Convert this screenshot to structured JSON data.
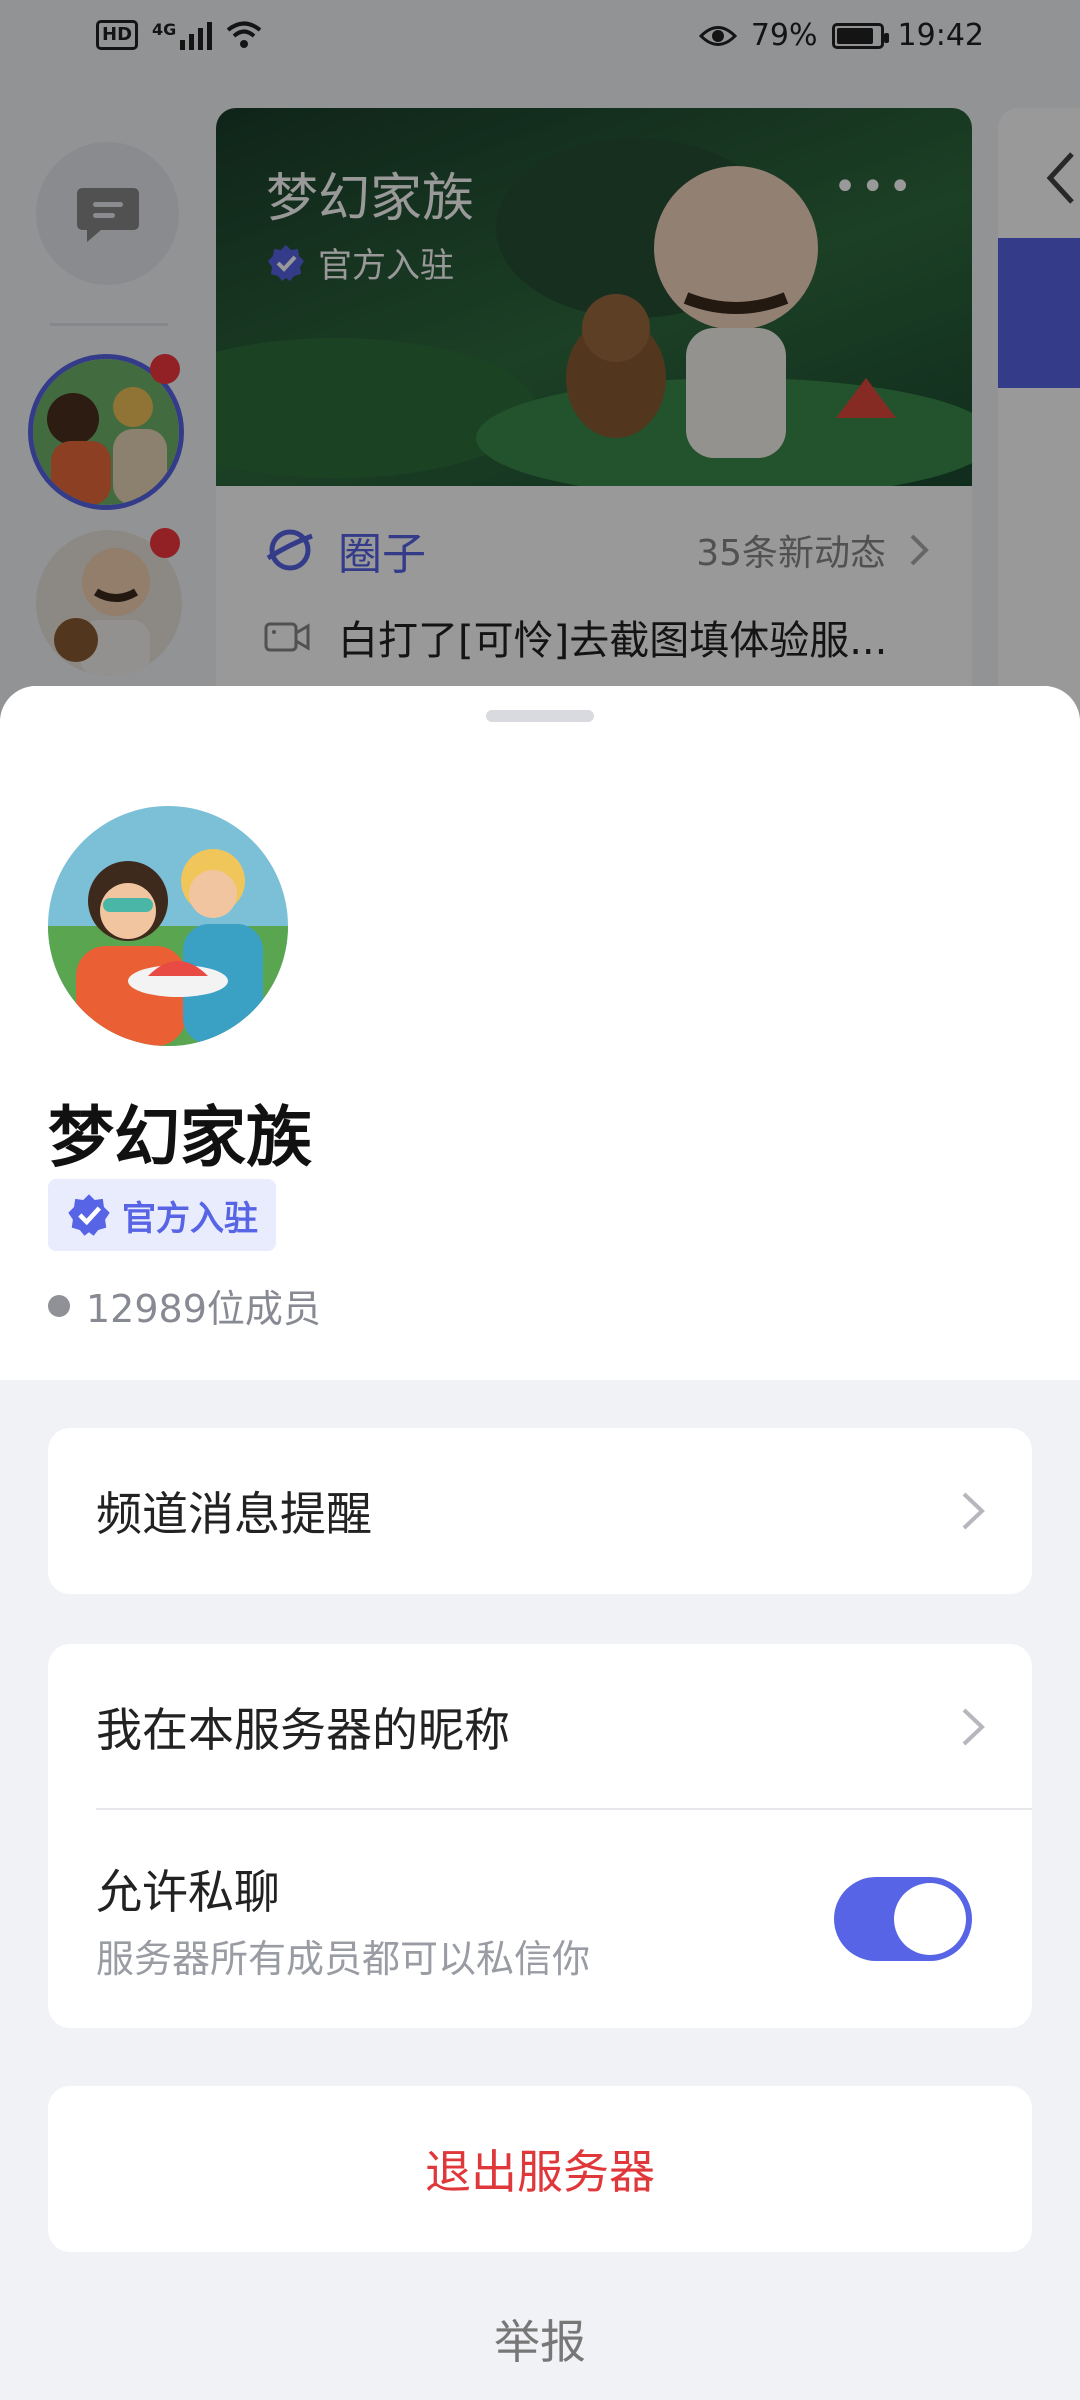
{
  "status_bar": {
    "network_badge": "HD",
    "signal_label": "4G",
    "battery_percent": "79%",
    "time": "19:42"
  },
  "background": {
    "card_title": "梦幻家族",
    "card_badge": "官方入驻",
    "circle_label": "圈子",
    "circle_count": "35条新动态",
    "latest_post": "白打了[可怜]去截图填体验服..."
  },
  "sheet": {
    "server_name": "梦幻家族",
    "official_badge": "官方入驻",
    "members": "12989位成员",
    "channel_notifications": "频道消息提醒",
    "nickname": "我在本服务器的昵称",
    "allow_dm": "允许私聊",
    "allow_dm_sub": "服务器所有成员都可以私信你",
    "allow_dm_on": true,
    "leave_server": "退出服务器",
    "report": "举报"
  },
  "colors": {
    "accent": "#5764e6",
    "danger": "#e0373b",
    "badge_bg": "#e9ecfd",
    "sheet_bg": "#f1f2f5"
  },
  "icons": [
    "message-icon",
    "verified-icon",
    "planet-icon",
    "video-icon",
    "chevron-right-icon",
    "wifi-icon",
    "eye-icon",
    "battery-icon"
  ]
}
